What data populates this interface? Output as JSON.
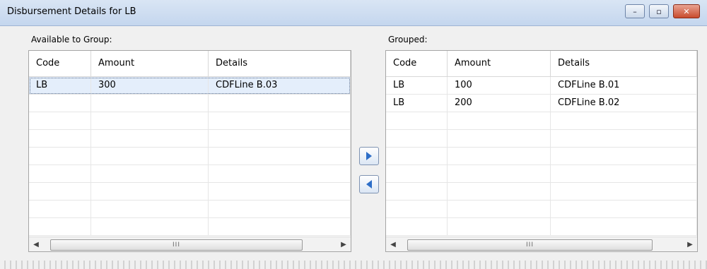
{
  "window": {
    "title": "Disbursement Details for LB",
    "controls": {
      "minimize": "–",
      "maximize": "▫",
      "close": "✕"
    }
  },
  "available": {
    "label": "Available to Group:",
    "columns": [
      "Code",
      "Amount",
      "Details"
    ],
    "rows": [
      {
        "code": "LB",
        "amount": "300",
        "details": "CDFLine B.03"
      }
    ],
    "scroll_thumb_mark": "III"
  },
  "grouped": {
    "label": "Grouped:",
    "columns": [
      "Code",
      "Amount",
      "Details"
    ],
    "rows": [
      {
        "code": "LB",
        "amount": "100",
        "details": "CDFLine B.01"
      },
      {
        "code": "LB",
        "amount": "200",
        "details": "CDFLine B.02"
      }
    ],
    "scroll_thumb_mark": "III"
  },
  "icons": {
    "move_right": "arrow-right-icon",
    "move_left": "arrow-left-icon",
    "scroll_left": "◀",
    "scroll_right": "▶"
  },
  "colors": {
    "titlebar": "#d9e5f4",
    "close_button": "#c84b2d",
    "arrow": "#2d6ec8",
    "selected_row": "#e4eefb"
  }
}
